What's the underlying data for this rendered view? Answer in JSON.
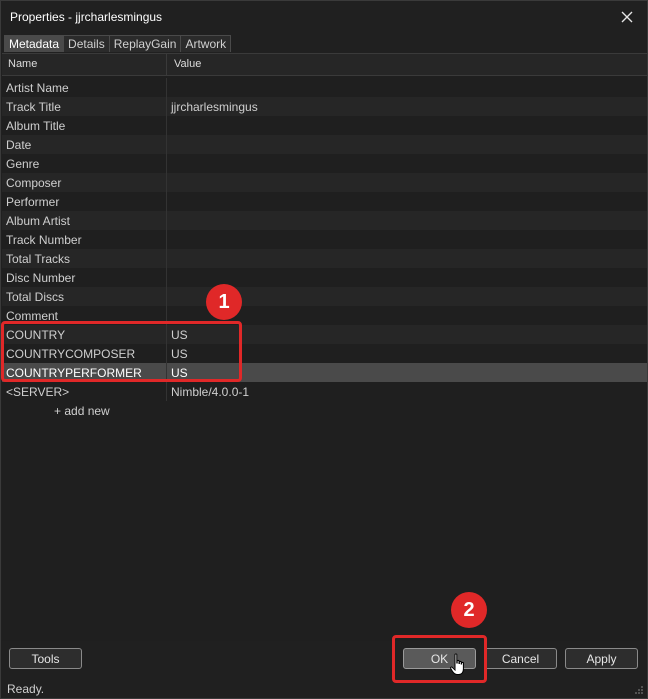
{
  "window": {
    "title": "Properties - jjrcharlesmingus"
  },
  "tabs": [
    {
      "label": "Metadata",
      "active": true
    },
    {
      "label": "Details",
      "active": false
    },
    {
      "label": "ReplayGain",
      "active": false
    },
    {
      "label": "Artwork",
      "active": false
    }
  ],
  "grid": {
    "columns": {
      "name": "Name",
      "value": "Value"
    },
    "rows": [
      {
        "name": "Artist Name",
        "value": ""
      },
      {
        "name": "Track Title",
        "value": "jjrcharlesmingus"
      },
      {
        "name": "Album Title",
        "value": ""
      },
      {
        "name": "Date",
        "value": ""
      },
      {
        "name": "Genre",
        "value": ""
      },
      {
        "name": "Composer",
        "value": ""
      },
      {
        "name": "Performer",
        "value": ""
      },
      {
        "name": "Album Artist",
        "value": ""
      },
      {
        "name": "Track Number",
        "value": ""
      },
      {
        "name": "Total Tracks",
        "value": ""
      },
      {
        "name": "Disc Number",
        "value": ""
      },
      {
        "name": "Total Discs",
        "value": ""
      },
      {
        "name": "Comment",
        "value": ""
      },
      {
        "name": "COUNTRY",
        "value": "US"
      },
      {
        "name": "COUNTRYCOMPOSER",
        "value": "US"
      },
      {
        "name": "COUNTRYPERFORMER",
        "value": "US"
      },
      {
        "name": "<SERVER>",
        "value": "Nimble/4.0.0-1"
      }
    ],
    "add_new_label": "+ add new"
  },
  "buttons": {
    "tools": "Tools",
    "ok": "OK",
    "cancel": "Cancel",
    "apply": "Apply"
  },
  "status": "Ready.",
  "annotations": {
    "badge1": "1",
    "badge2": "2",
    "color": "#e02828"
  },
  "icons": {
    "close": "close-icon",
    "cursor": "hand-pointer-icon"
  }
}
